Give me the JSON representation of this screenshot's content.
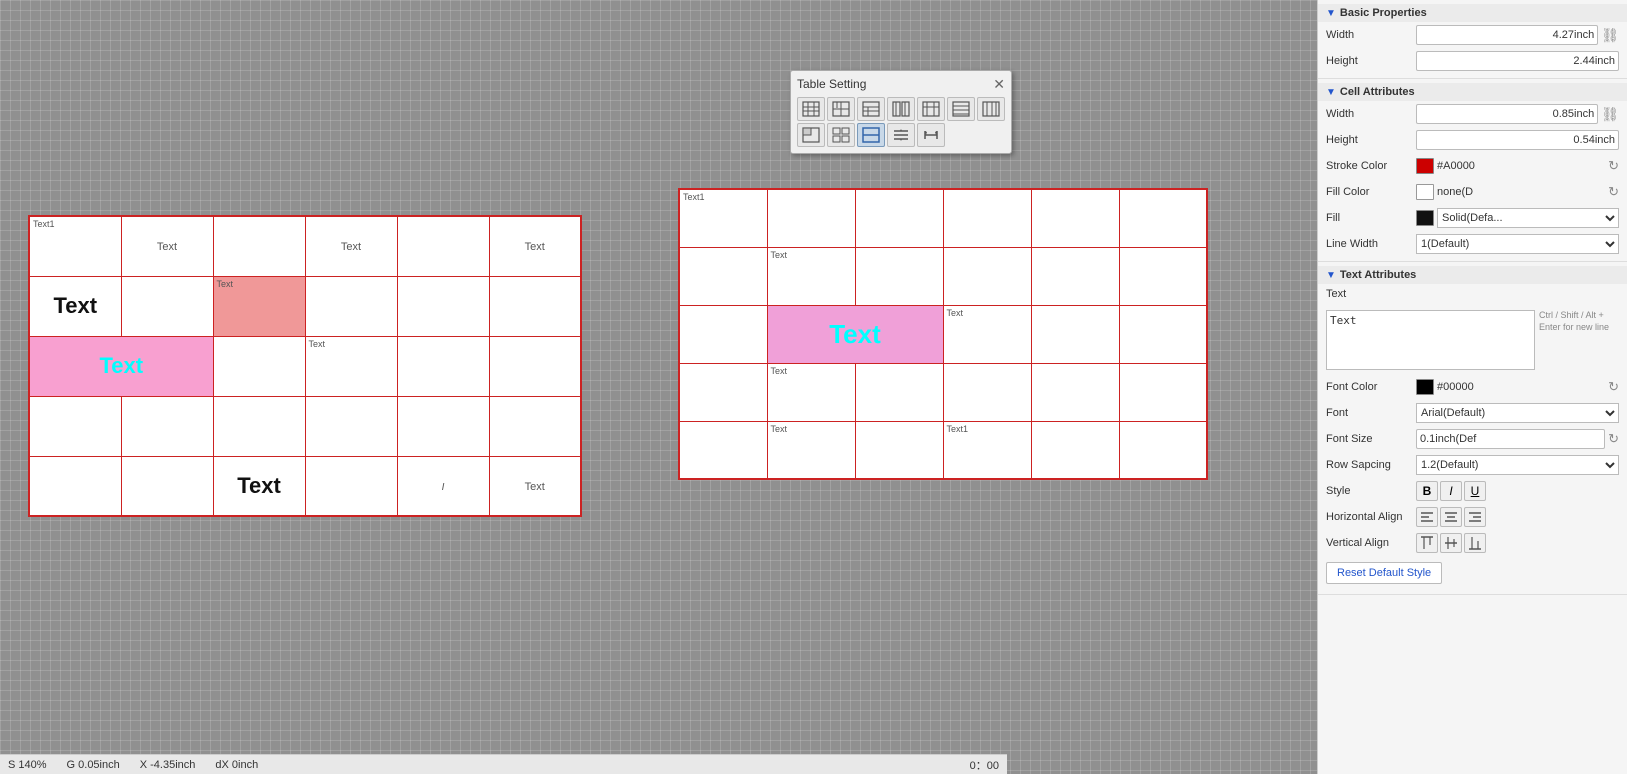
{
  "canvas": {
    "background": "#909090"
  },
  "tableSettingPopup": {
    "title": "Table Setting",
    "closeLabel": "✕",
    "icons": [
      "⊞",
      "⊟",
      "⊠",
      "⊡",
      "⊢",
      "⊣",
      "⊤",
      "⊥",
      "⊦",
      "⊧",
      "⊨",
      "⊩"
    ]
  },
  "leftTable": {
    "cells": [
      [
        {
          "text": "Text1",
          "small": true,
          "position": "topleft"
        },
        {
          "text": "Text",
          "style": "normal"
        },
        {
          "text": "",
          "style": "normal"
        },
        {
          "text": "Text",
          "style": "normal"
        },
        {
          "text": "",
          "style": "normal"
        },
        {
          "text": "Text",
          "style": "normal"
        }
      ],
      [
        {
          "text": "Text",
          "style": "bold-large"
        },
        {
          "text": "",
          "style": "normal"
        },
        {
          "text": "Text",
          "small": true,
          "position": "topleft",
          "bg": "salmon"
        },
        {
          "text": "",
          "style": "normal"
        },
        {
          "text": "",
          "style": "normal"
        },
        {
          "text": "",
          "style": "normal"
        }
      ],
      [
        {
          "text": "Text",
          "style": "cyan-large",
          "bg": "pink"
        },
        {
          "text": "",
          "style": "normal"
        },
        {
          "text": "",
          "style": "normal"
        },
        {
          "text": "Text",
          "small": true,
          "position": "topleft"
        },
        {
          "text": "",
          "style": "normal"
        },
        {
          "text": "",
          "style": "normal"
        }
      ],
      [
        {
          "text": "",
          "style": "normal"
        },
        {
          "text": "",
          "style": "normal"
        },
        {
          "text": "",
          "style": "normal"
        },
        {
          "text": "",
          "style": "normal"
        },
        {
          "text": "",
          "style": "normal"
        },
        {
          "text": "",
          "style": "normal"
        }
      ],
      [
        {
          "text": "",
          "style": "normal"
        },
        {
          "text": "",
          "style": "normal"
        },
        {
          "text": "Text",
          "style": "bold-large"
        },
        {
          "text": "",
          "style": "normal"
        },
        {
          "text": "I",
          "italic": true
        },
        {
          "text": "Text",
          "style": "normal"
        }
      ]
    ]
  },
  "rightTable": {
    "cells": [
      [
        {
          "text": "Text1",
          "small": true
        },
        {
          "text": ""
        },
        {
          "text": ""
        },
        {
          "text": ""
        },
        {
          "text": ""
        },
        {
          "text": ""
        }
      ],
      [
        {
          "text": ""
        },
        {
          "text": "Text",
          "small": true
        },
        {
          "text": ""
        },
        {
          "text": ""
        },
        {
          "text": ""
        },
        {
          "text": ""
        }
      ],
      [
        {
          "text": ""
        },
        {
          "text": "Text",
          "style": "cyan-large",
          "bg": "pink",
          "colspan": 2
        },
        {
          "text": "Text",
          "small": true
        },
        {
          "text": ""
        },
        {
          "text": ""
        }
      ],
      [
        {
          "text": ""
        },
        {
          "text": "Text",
          "small": true
        },
        {
          "text": ""
        },
        {
          "text": ""
        },
        {
          "text": ""
        },
        {
          "text": ""
        }
      ],
      [
        {
          "text": ""
        },
        {
          "text": "Text",
          "small": true
        },
        {
          "text": ""
        },
        {
          "text": "Text1",
          "small": true
        },
        {
          "text": ""
        },
        {
          "text": ""
        }
      ]
    ]
  },
  "rightPanel": {
    "basicProperties": {
      "title": "Basic Properties",
      "width": {
        "label": "Width",
        "value": "4.27inch"
      },
      "height": {
        "label": "Height",
        "value": "2.44inch"
      }
    },
    "cellAttributes": {
      "title": "Cell Attributes",
      "width": {
        "label": "Width",
        "value": "0.85inch"
      },
      "height": {
        "label": "Height",
        "value": "0.54inch"
      },
      "strokeColor": {
        "label": "Stroke Color",
        "value": "#A0000",
        "color": "#cc0000"
      },
      "fillColor": {
        "label": "Fill Color",
        "value": "none(D",
        "color": "#ffffff"
      },
      "fill": {
        "label": "Fill",
        "value": "Solid(Defa..."
      },
      "lineWidth": {
        "label": "Line Width",
        "value": "1(Default)"
      }
    },
    "textAttributes": {
      "title": "Text Attributes",
      "textLabel": "Text",
      "textValue": "Text",
      "hint": "Ctrl / Shift / Alt + Enter for new line",
      "fontColor": {
        "label": "Font Color",
        "value": "#00000",
        "color": "#000000"
      },
      "font": {
        "label": "Font",
        "value": "Arial(Default)"
      },
      "fontSize": {
        "label": "Font Size",
        "value": "0.1inch(Def"
      },
      "rowSpacing": {
        "label": "Row Sapcing",
        "value": "1.2(Default)"
      },
      "style": {
        "label": "Style",
        "bold": "B",
        "italic": "I",
        "underline": "U"
      },
      "horizontalAlign": {
        "label": "Horizontal Align"
      },
      "verticalAlign": {
        "label": "Vertical Align"
      },
      "resetButton": "Reset Default Style"
    },
    "statusBar": {
      "s": "S  140%",
      "g": "G  0.05inch",
      "x": "X  -4.35inch",
      "dx": "dX  0inch",
      "time": "0：00"
    }
  }
}
